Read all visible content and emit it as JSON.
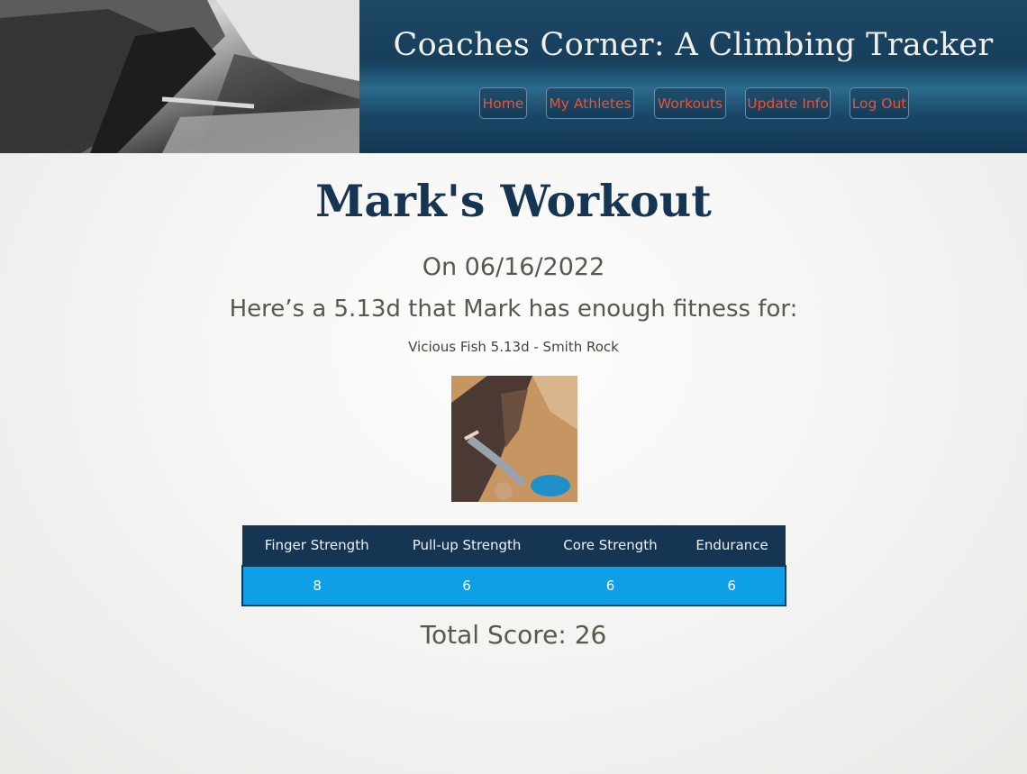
{
  "header": {
    "title": "Coaches Corner: A Climbing Tracker",
    "nav": [
      {
        "label": "Home"
      },
      {
        "label": "My Athletes"
      },
      {
        "label": "Workouts"
      },
      {
        "label": "Update Info"
      },
      {
        "label": "Log Out"
      }
    ]
  },
  "main": {
    "title": "Mark's Workout",
    "date_line": "On 06/16/2022",
    "fitness_line": "Here’s a 5.13d that Mark has enough fitness for:",
    "route_name": "Vicious Fish 5.13d - Smith Rock",
    "stats": {
      "headers": [
        "Finger Strength",
        "Pull-up Strength",
        "Core Strength",
        "Endurance"
      ],
      "values": [
        "8",
        "6",
        "6",
        "6"
      ]
    },
    "total_score": "Total Score: 26"
  },
  "colors": {
    "header_bg": "#163f5c",
    "nav_text": "#e2553d",
    "title_text": "#163552",
    "table_header_bg": "#163552",
    "table_row_bg": "#0ea0e6",
    "body_text": "#545a4c"
  },
  "icons": {
    "hero_image": "black-and-white-boulder-climbing-photo",
    "route_photo": "crack-climber-photo"
  }
}
